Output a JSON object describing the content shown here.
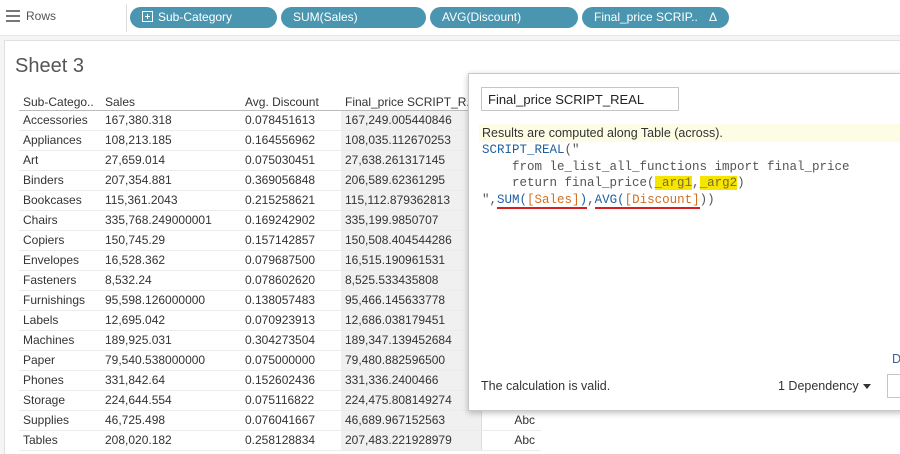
{
  "shelf": {
    "label": "Rows",
    "pills": [
      {
        "label": "Sub-Category"
      },
      {
        "label": "SUM(Sales)"
      },
      {
        "label": "AVG(Discount)"
      },
      {
        "label": "Final_price SCRIP..",
        "badge": "Δ"
      }
    ]
  },
  "sheet": {
    "title": "Sheet 3",
    "columns": [
      "Sub-Catego..",
      "Sales",
      "Avg. Discount",
      "Final_price SCRIPT_R.."
    ],
    "rows": [
      [
        "Accessories",
        "167,380.318",
        "0.078451613",
        "167,249.005440846",
        ""
      ],
      [
        "Appliances",
        "108,213.185",
        "0.164556962",
        "108,035.112670253",
        ""
      ],
      [
        "Art",
        "27,659.014",
        "0.075030451",
        "27,638.261317145",
        ""
      ],
      [
        "Binders",
        "207,354.881",
        "0.369056848",
        "206,589.62361295",
        ""
      ],
      [
        "Bookcases",
        "115,361.2043",
        "0.215258621",
        "115,112.879362813",
        ""
      ],
      [
        "Chairs",
        "335,768.249000001",
        "0.169242902",
        "335,199.9850707",
        ""
      ],
      [
        "Copiers",
        "150,745.29",
        "0.157142857",
        "150,508.404544286",
        ""
      ],
      [
        "Envelopes",
        "16,528.362",
        "0.079687500",
        "16,515.190961531",
        ""
      ],
      [
        "Fasteners",
        "8,532.24",
        "0.078602620",
        "8,525.533435808",
        ""
      ],
      [
        "Furnishings",
        "95,598.126000000",
        "0.138057483",
        "95,466.145633778",
        ""
      ],
      [
        "Labels",
        "12,695.042",
        "0.070923913",
        "12,686.038179451",
        ""
      ],
      [
        "Machines",
        "189,925.031",
        "0.304273504",
        "189,347.139452684",
        ""
      ],
      [
        "Paper",
        "79,540.538000000",
        "0.075000000",
        "79,480.882596500",
        ""
      ],
      [
        "Phones",
        "331,842.64",
        "0.152602436",
        "331,336.2400466",
        ""
      ],
      [
        "Storage",
        "224,644.554",
        "0.075116822",
        "224,475.808149274",
        ""
      ],
      [
        "Supplies",
        "46,725.498",
        "0.076041667",
        "46,689.967152563",
        "Abc"
      ],
      [
        "Tables",
        "208,020.182",
        "0.258128834",
        "207,483.221928979",
        "Abc"
      ]
    ]
  },
  "dialog": {
    "calc_name": "Final_price SCRIPT_REAL",
    "results_note": "Results are computed along Table (across).",
    "code": {
      "l1_fn": "SCRIPT_REAL",
      "l1_rest": "(\"",
      "l2": "    from le_list_all_functions import final_price",
      "l3_pre": "    return final_price(",
      "arg1": "_arg1",
      "comma": ",",
      "arg2": "_arg2",
      "l3_post": ")",
      "l4_pre": "\",",
      "sum_fn": "SUM",
      "sum_field": "[Sales]",
      "avg_fn": "AVG",
      "avg_field": "[Discount]",
      "l4_post": "))"
    },
    "link": "D",
    "status": "The calculation is valid.",
    "dependency": "1 Dependency"
  }
}
